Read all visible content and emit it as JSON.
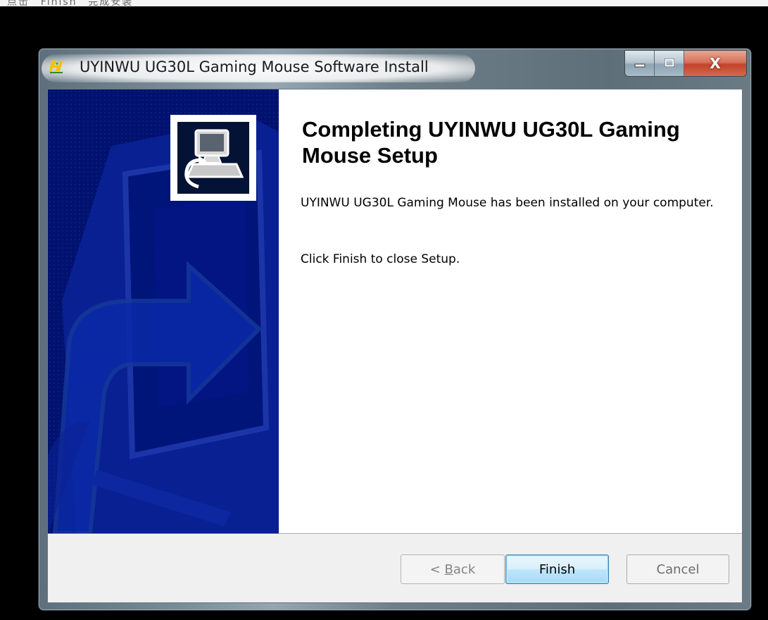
{
  "top_strip_note": "点击 “Finish” 完成安装",
  "window": {
    "title": "UYINWU UG30L Gaming Mouse Software Install",
    "close_glyph": "X"
  },
  "content": {
    "heading": "Completing UYINWU UG30L Gaming Mouse Setup",
    "body_line1": "UYINWU UG30L Gaming Mouse has been installed on your computer.",
    "body_line2": "Click Finish to close Setup."
  },
  "buttons": {
    "back_prefix": "< ",
    "back_mnemonic": "B",
    "back_rest": "ack",
    "finish": "Finish",
    "cancel": "Cancel"
  },
  "icons": {
    "app": "uyinwu-logo-icon",
    "header": "computer-install-icon",
    "minimize": "minimize-icon",
    "maximize": "maximize-icon",
    "close": "close-icon"
  },
  "colors": {
    "sidebar": "#00126e",
    "default_button_border": "#3c7fb1"
  }
}
